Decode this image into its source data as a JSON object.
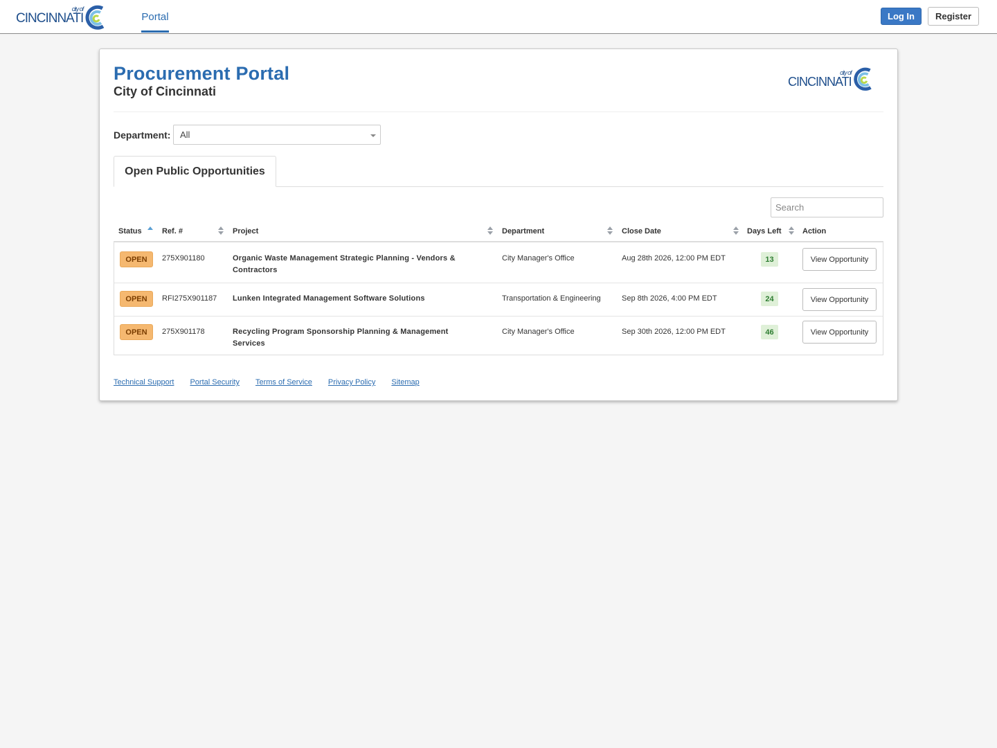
{
  "nav": {
    "logo_text": "CINCINNATI",
    "logo_small": "city of",
    "portal_tab": "Portal",
    "login_label": "Log In",
    "register_label": "Register"
  },
  "header": {
    "title": "Procurement Portal",
    "subtitle": "City of Cincinnati"
  },
  "filter": {
    "department_label": "Department:",
    "department_value": "All"
  },
  "tabs": [
    {
      "label": "Open Public Opportunities",
      "active": true
    }
  ],
  "search": {
    "placeholder": "Search"
  },
  "table": {
    "columns": [
      "Status",
      "Ref. #",
      "Project",
      "Department",
      "Close Date",
      "Days Left",
      "Action"
    ],
    "rows": [
      {
        "status": "OPEN",
        "ref": "275X901180",
        "project": "Organic Waste Management Strategic Planning - Vendors & Contractors",
        "department": "City Manager's Office",
        "close_date": "Aug 28th 2026, 12:00 PM EDT",
        "days_left": "13",
        "action": "View Opportunity"
      },
      {
        "status": "OPEN",
        "ref": "RFI275X901187",
        "project": "Lunken Integrated Management Software Solutions",
        "department": "Transportation & Engineering",
        "close_date": "Sep 8th 2026, 4:00 PM EDT",
        "days_left": "24",
        "action": "View Opportunity"
      },
      {
        "status": "OPEN",
        "ref": "275X901178",
        "project": "Recycling Program Sponsorship Planning & Management Services",
        "department": "City Manager's Office",
        "close_date": "Sep 30th 2026, 12:00 PM EDT",
        "days_left": "46",
        "action": "View Opportunity"
      }
    ]
  },
  "footer": {
    "links": [
      "Technical Support",
      "Portal Security",
      "Terms of Service",
      "Privacy Policy",
      "Sitemap"
    ]
  },
  "colors": {
    "brand_blue": "#2b6cb0",
    "open_badge": "#f5b870",
    "days_badge": "#dff0d8"
  }
}
